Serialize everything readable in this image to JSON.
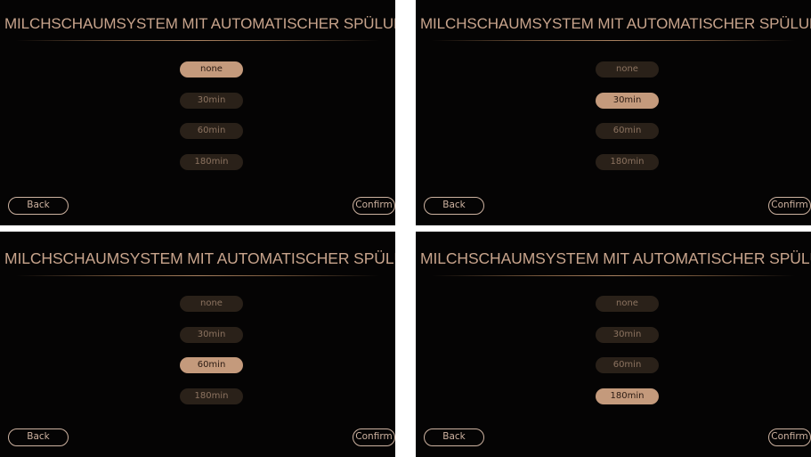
{
  "panels": [
    {
      "title": "MILCHSCHAUMSYSTEM MIT AUTOMATISCHER SPÜLUNG",
      "options": [
        "none",
        "30min",
        "60min",
        "180min"
      ],
      "selected_index": 0,
      "back_label": "Back",
      "confirm_label": "Confirm"
    },
    {
      "title": "MILCHSCHAUMSYSTEM MIT AUTOMATISCHER SPÜLUNG",
      "options": [
        "none",
        "30min",
        "60min",
        "180min"
      ],
      "selected_index": 1,
      "back_label": "Back",
      "confirm_label": "Confirm"
    },
    {
      "title": "MILCHSCHAUMSYSTEM MIT AUTOMATISCHER SPÜLUNG",
      "options": [
        "none",
        "30min",
        "60min",
        "180min"
      ],
      "selected_index": 2,
      "back_label": "Back",
      "confirm_label": "Confirm"
    },
    {
      "title": "MILCHSCHAUMSYSTEM MIT AUTOMATISCHER SPÜLUNG",
      "options": [
        "none",
        "30min",
        "60min",
        "180min"
      ],
      "selected_index": 3,
      "back_label": "Back",
      "confirm_label": "Confirm"
    }
  ],
  "colors": {
    "background": "#050404",
    "title": "#c8a48c",
    "option_idle_bg": "#2a2119",
    "option_idle_text": "#8c7360",
    "option_selected_bg": "#c49a7c",
    "option_selected_text": "#2a1a12",
    "button_outline": "#cdb2a0"
  }
}
